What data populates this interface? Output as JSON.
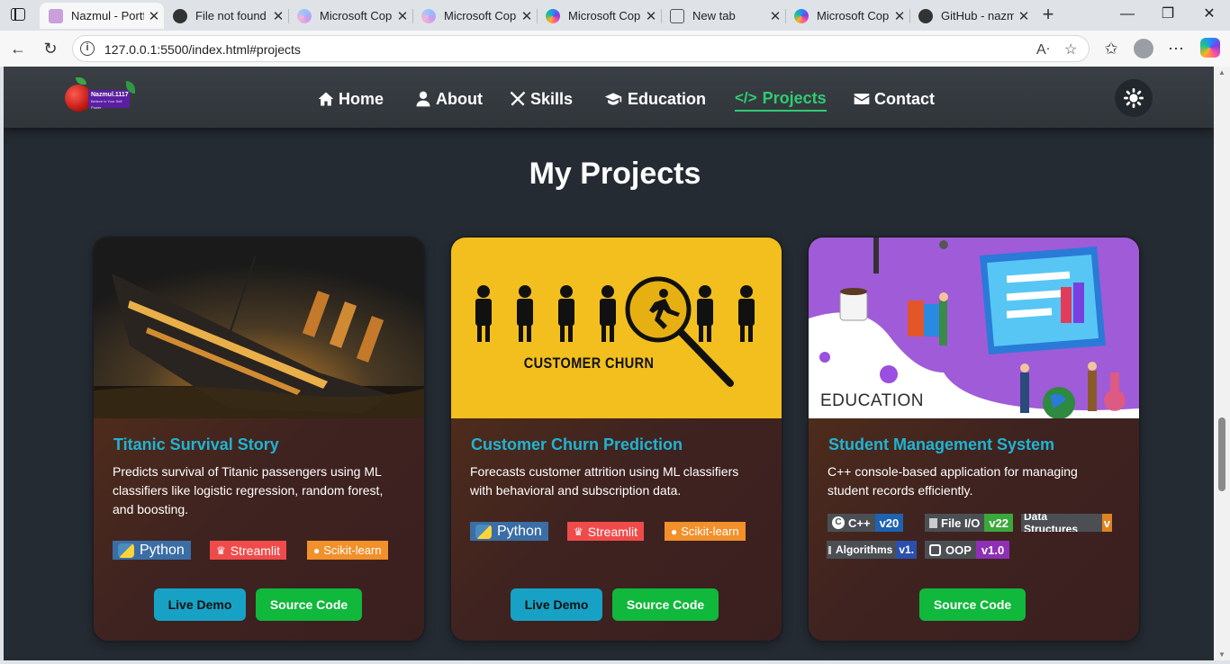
{
  "browser": {
    "tabs": [
      {
        "title": "Nazmul - Portf",
        "active": true,
        "favicon_color": "#c9a0dc"
      },
      {
        "title": "File not found",
        "active": false,
        "favicon_color": "#333333"
      },
      {
        "title": "Microsoft Cop",
        "active": false,
        "favicon_color": "#8b7fe0"
      },
      {
        "title": "Microsoft Cop",
        "active": false,
        "favicon_color": "#8b7fe0"
      },
      {
        "title": "Microsoft Cop",
        "active": false,
        "favicon_color": "#2f7de1"
      },
      {
        "title": "New tab",
        "active": false,
        "favicon_color": "#777777"
      },
      {
        "title": "Microsoft Cop",
        "active": false,
        "favicon_color": "#2f7de1"
      },
      {
        "title": "GitHub - nazm",
        "active": false,
        "favicon_color": "#333333"
      }
    ],
    "url": "127.0.0.1:5500/index.html#projects"
  },
  "site": {
    "logo": {
      "name": "Nazmul.1117",
      "tagline": "Believe in Your Self Power"
    },
    "nav": [
      {
        "label": "Home",
        "icon": "home-icon"
      },
      {
        "label": "About",
        "icon": "user-icon"
      },
      {
        "label": "Skills",
        "icon": "tools-icon"
      },
      {
        "label": "Education",
        "icon": "graduation-cap-icon"
      },
      {
        "label": "Projects",
        "icon": "code-icon",
        "active": true
      },
      {
        "label": "Contact",
        "icon": "envelope-icon"
      }
    ],
    "accent": "#2ecc71"
  },
  "projects": {
    "heading": "My Projects",
    "cards": [
      {
        "title": "Titanic Survival Story",
        "description": "Predicts survival of Titanic passengers using ML classifiers like logistic regression, random forest, and boosting.",
        "badges": [
          "Python",
          "Streamlit",
          "Scikit-learn"
        ],
        "live_demo": "Live Demo",
        "source": "Source Code"
      },
      {
        "title": "Customer Churn Prediction",
        "description": "Forecasts customer attrition using ML classifiers with behavioral and subscription data.",
        "image_text": "CUSTOMER CHURN",
        "badges": [
          "Python",
          "Streamlit",
          "Scikit-learn"
        ],
        "live_demo": "Live Demo",
        "source": "Source Code"
      },
      {
        "title": "Student Management System",
        "description": "C++ console-based application for managing student records efficiently.",
        "image_text": "EDUCATION",
        "badges": [
          {
            "label": "C++",
            "value": "v20",
            "color": "#1e62b0"
          },
          {
            "label": "File I/O",
            "value": "v22",
            "color": "#3aa83a"
          },
          {
            "label": "Data Structures",
            "value": "v",
            "color": "#e0821e"
          },
          {
            "label": "Algorithms",
            "value": "v1.",
            "color": "#2a4fae"
          },
          {
            "label": "OOP",
            "value": "v1.0",
            "color": "#8e2fb5"
          }
        ],
        "source": "Source Code"
      }
    ]
  }
}
